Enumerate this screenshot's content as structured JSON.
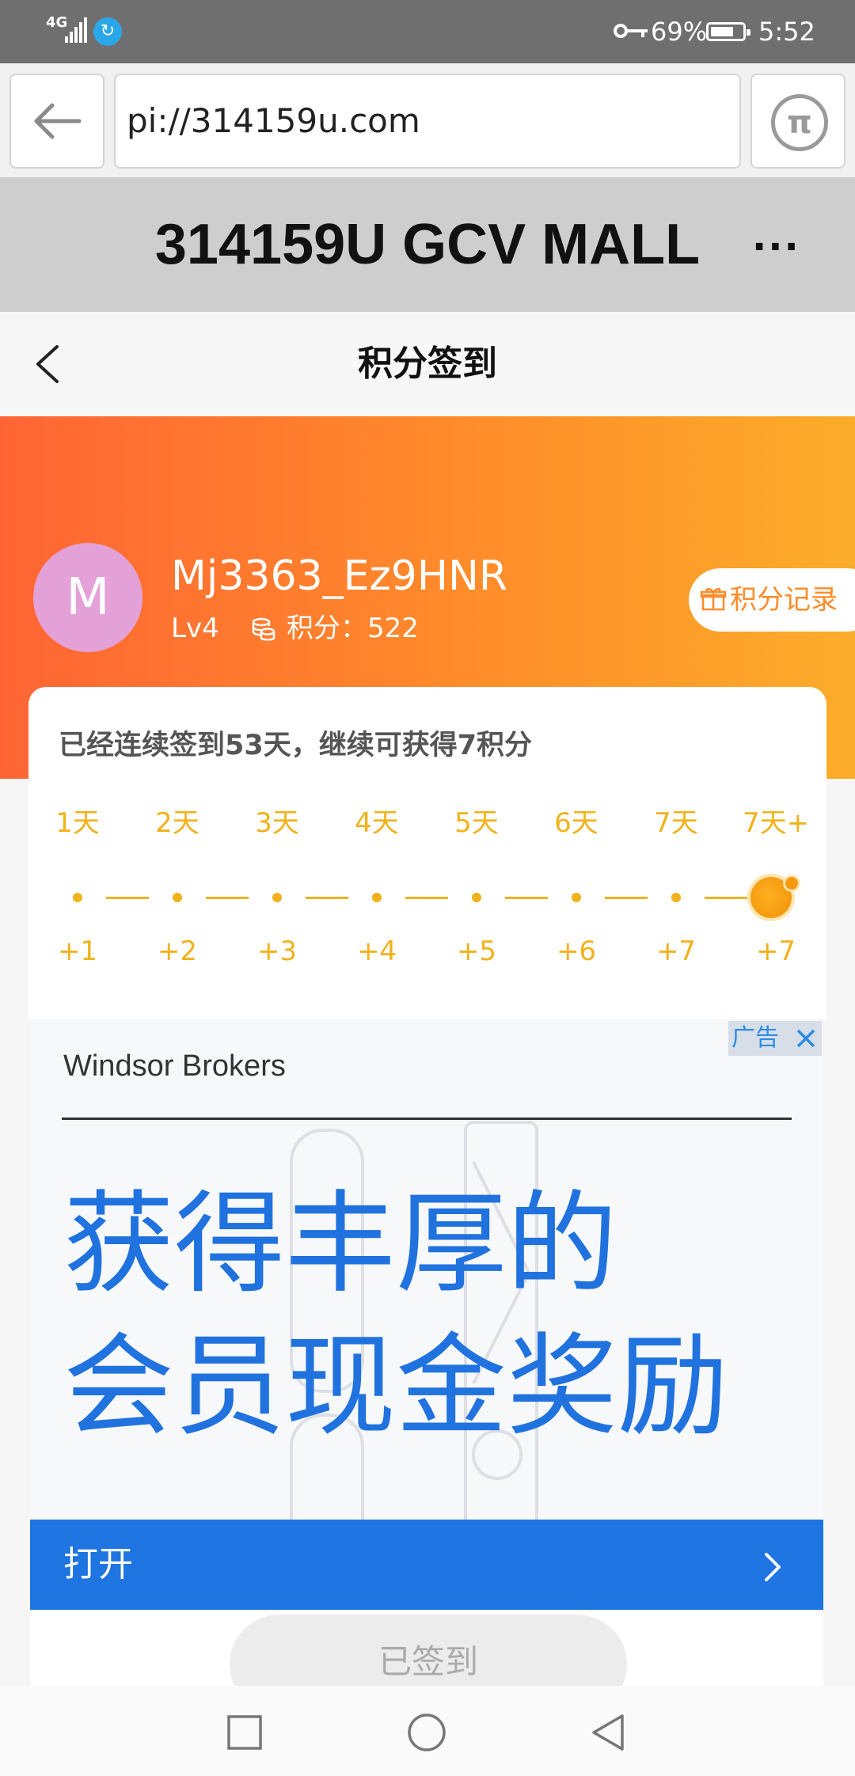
{
  "status_bar": {
    "network": "4G",
    "battery_percent": "69%",
    "time": "5:52"
  },
  "browser": {
    "url": "pi://314159u.com"
  },
  "site": {
    "title": "314159U GCV MALL",
    "more": "···"
  },
  "page": {
    "title": "积分签到"
  },
  "user": {
    "avatar_letter": "M",
    "name": "Mj3363_Ez9HNR",
    "level": "Lv4",
    "points": "积分：522",
    "records_label": "积分记录"
  },
  "checkin": {
    "streak_text": "已经连续签到53天，继续可获得7积分",
    "days": [
      {
        "label": "1天",
        "reward": "+1"
      },
      {
        "label": "2天",
        "reward": "+2"
      },
      {
        "label": "3天",
        "reward": "+3"
      },
      {
        "label": "4天",
        "reward": "+4"
      },
      {
        "label": "5天",
        "reward": "+5"
      },
      {
        "label": "6天",
        "reward": "+6"
      },
      {
        "label": "7天",
        "reward": "+7"
      },
      {
        "label": "7天+",
        "reward": "+7"
      }
    ],
    "signed_label": "已签到"
  },
  "ad": {
    "brand": "Windsor Brokers",
    "tag": "广告",
    "headline_1": "获得丰厚的",
    "headline_2": "会员现金奖励",
    "open_label": "打开"
  },
  "colors": {
    "accent_orange": "#ff8c2a",
    "ad_blue": "#1e74e0",
    "gold": "#f2b21b"
  }
}
